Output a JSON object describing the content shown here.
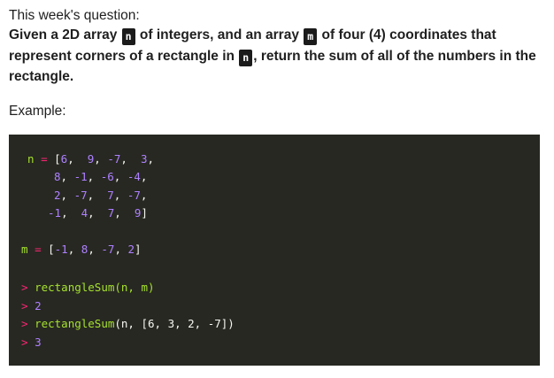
{
  "intro": "This week's question:",
  "question": {
    "part1": "Given a 2D array",
    "var_n": "n",
    "part2": "of integers, and an array",
    "var_m": "m",
    "part3": "of four (4) coordinates that represent corners of a rectangle in",
    "var_n2": "n",
    "part4": ", return the sum of all of the numbers in the rectangle."
  },
  "example_label": "Example:",
  "code": {
    "n_name": "n",
    "eq": "=",
    "n_rows": [
      [
        "6",
        "9",
        "-7",
        "3"
      ],
      [
        "8",
        "-1",
        "-6",
        "-4"
      ],
      [
        "2",
        "-7",
        "7",
        "-7"
      ],
      [
        "-1",
        "4",
        "7",
        "9"
      ]
    ],
    "m_name": "m",
    "m_values": [
      "-1",
      "8",
      "-7",
      "2"
    ],
    "prompt": ">",
    "call1": "rectangleSum(n, m)",
    "result1": "2",
    "call2_fn": "rectangleSum",
    "call2_args": "(n, [6, 3, 2, -7])",
    "result2": "3"
  },
  "colors": {
    "code_background": "#272822",
    "green": "#a6e22e",
    "pink": "#f92672",
    "purple": "#ae81ff"
  }
}
